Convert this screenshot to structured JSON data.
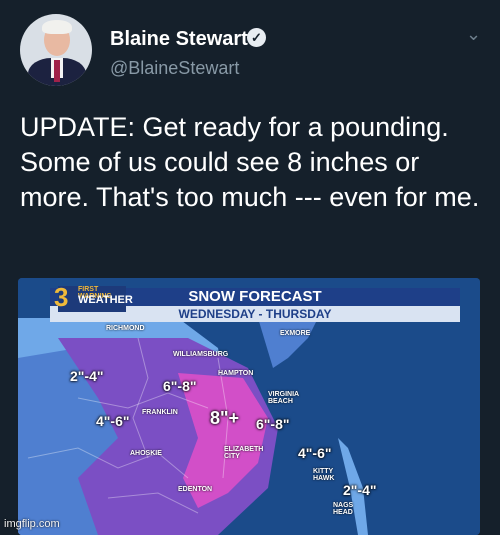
{
  "author": {
    "name": "Blaine Stewart",
    "handle": "@BlaineStewart"
  },
  "tweet": {
    "text": "UPDATE: Get ready for a pounding. Some of us could see 8 inches or more. That's too much --- even for me."
  },
  "map": {
    "logo_number": "3",
    "logo_sub": "FIRST WARNING",
    "logo_name": "WEATHER",
    "title": "SNOW FORECAST",
    "subtitle": "WEDNESDAY - THURSDAY",
    "cities": {
      "richmond": "RICHMOND",
      "exmore": "EXMORE",
      "williamsburg": "WILLIAMSBURG",
      "hampton": "HAMPTON",
      "franklin": "FRANKLIN",
      "virginia_beach": "VIRGINIA BEACH",
      "ahoskie": "AHOSKIE",
      "elizabeth_city": "ELIZABETH CITY",
      "kitty_hawk": "KITTY HAWK",
      "edenton": "EDENTON",
      "nags_head": "NAGS HEAD"
    },
    "amounts": {
      "a1": "2\"-4\"",
      "a2": "6\"-8\"",
      "a3": "4\"-6\"",
      "a4": "8\"+",
      "a5": "6\"-8\"",
      "a6": "4\"-6\"",
      "a7": "2\"-4\""
    },
    "colors": {
      "water": "#1b4b8a",
      "light_blue": "#6fa8e8",
      "mid_blue": "#4f7fd0",
      "purple": "#7b4fc4",
      "pink": "#d24fc8"
    }
  },
  "watermark": "imgflip.com"
}
